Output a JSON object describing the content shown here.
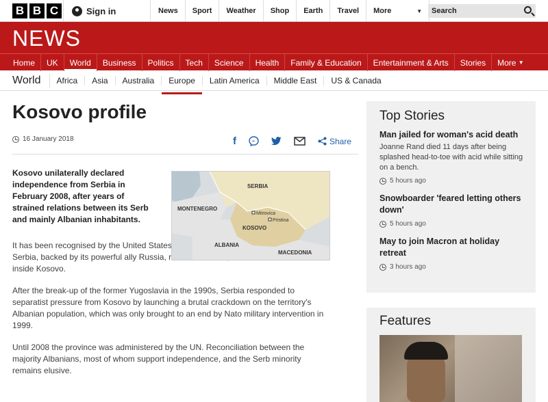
{
  "header": {
    "logo_letters": [
      "B",
      "B",
      "C"
    ],
    "signin": "Sign in",
    "nav": [
      "News",
      "Sport",
      "Weather",
      "Shop",
      "Earth",
      "Travel"
    ],
    "more": "More",
    "search_placeholder": "Search"
  },
  "brand": {
    "news_label": "NEWS",
    "color": "#bb1919"
  },
  "main_nav": [
    "Home",
    "UK",
    "World",
    "Business",
    "Politics",
    "Tech",
    "Science",
    "Health",
    "Family & Education",
    "Entertainment & Arts",
    "Stories",
    "More"
  ],
  "sub_nav": {
    "section": "World",
    "items": [
      "Africa",
      "Asia",
      "Australia",
      "Europe",
      "Latin America",
      "Middle East",
      "US & Canada"
    ]
  },
  "article": {
    "title": "Kosovo profile",
    "date": "16 January 2018",
    "share_label": "Share",
    "lead": "Kosovo unilaterally declared independence from Serbia in February 2008, after years of strained relations between its Serb and mainly Albanian inhabitants.",
    "p1": "It has been recognised by the United States and major European Union countries, but Serbia, backed by its powerful ally Russia, refuses to do so, as do most ethnic Serbs inside Kosovo.",
    "p2": "After the break-up of the former Yugoslavia in the 1990s, Serbia responded to separatist pressure from Kosovo by launching a brutal crackdown on the territory's Albanian population, which was only brought to an end by Nato military intervention in 1999.",
    "p3": "Until 2008 the province was administered by the UN. Reconciliation between the majority Albanians, most of whom support independence, and the Serb minority remains elusive."
  },
  "map": {
    "labels": {
      "serbia": "SERBIA",
      "montenegro": "MONTENEGRO",
      "mitrovica": "Mitrovica",
      "pristina": "Pristina",
      "kosovo": "KOSOVO",
      "albania": "ALBANIA",
      "macedonia": "MACEDONIA"
    }
  },
  "top_stories": {
    "title": "Top Stories",
    "items": [
      {
        "headline": "Man jailed for woman's acid death",
        "summary": "Joanne Rand died 11 days after being splashed head-to-toe with acid while sitting on a bench.",
        "time": "5 hours ago"
      },
      {
        "headline": "Snowboarder 'feared letting others down'",
        "summary": "",
        "time": "5 hours ago"
      },
      {
        "headline": "May to join Macron at holiday retreat",
        "summary": "",
        "time": "3 hours ago"
      }
    ]
  },
  "features": {
    "title": "Features"
  }
}
